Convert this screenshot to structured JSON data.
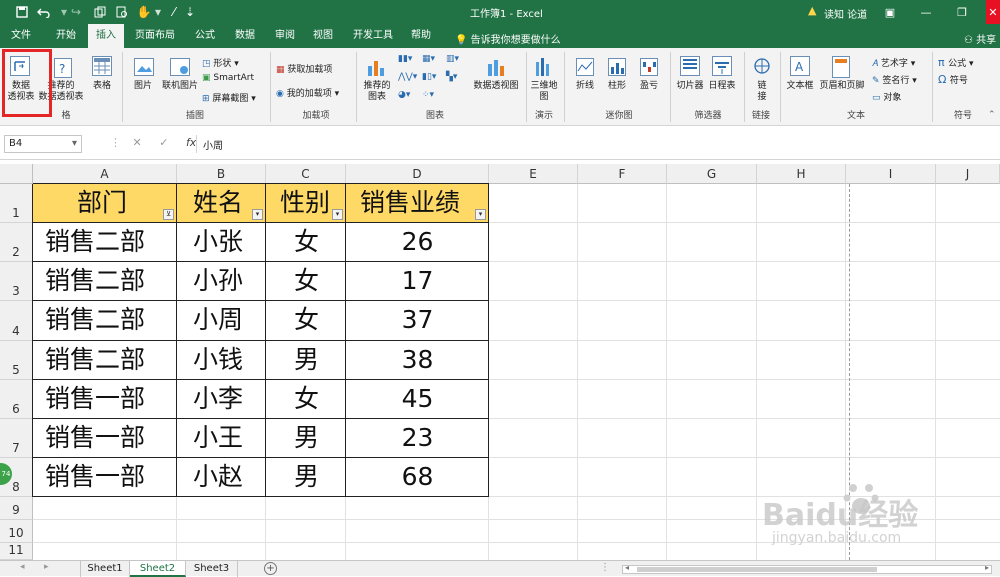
{
  "titlebar": {
    "doc_title": "工作簿1 - Excel",
    "user": "读知 论道",
    "quick_access": [
      "save-icon",
      "undo-icon",
      "redo-icon",
      "copy-icon",
      "preview-icon",
      "touch-icon",
      "more-icon"
    ]
  },
  "menu": {
    "tabs": [
      "文件",
      "开始",
      "插入",
      "页面布局",
      "公式",
      "数据",
      "审阅",
      "视图",
      "开发工具",
      "帮助"
    ],
    "active": "插入",
    "tellme": "告诉我你想要做什么",
    "share": "共享"
  },
  "ribbon": {
    "pivot_table": "数据\n透视表",
    "recommended_pivot": "推荐的\n数据透视表",
    "table": "表格",
    "group_tables": "格",
    "picture": "图片",
    "online_picture": "联机图片",
    "shapes": "形状",
    "smartart": "SmartArt",
    "screenshot": "屏幕截图",
    "group_illustrations": "插图",
    "get_addins": "获取加载项",
    "my_addins": "我的加载项",
    "group_addins": "加载项",
    "recommended_charts": "推荐的\n图表",
    "pivot_chart": "数据透视图",
    "group_charts": "图表",
    "map3d": "三维地\n图",
    "group_tours": "演示",
    "sp_line": "折线",
    "sp_column": "柱形",
    "sp_winloss": "盈亏",
    "group_sparklines": "迷你图",
    "slicer": "切片器",
    "timeline": "日程表",
    "group_filters": "筛选器",
    "link": "链\n接",
    "group_links": "链接",
    "textbox": "文本框",
    "header_footer": "页眉和页脚",
    "wordart": "艺术字",
    "signature": "签名行",
    "object": "对象",
    "group_text": "文本",
    "equation": "公式",
    "symbol": "符号",
    "group_symbols": "符号"
  },
  "formula_bar": {
    "name_box": "B4",
    "formula": "小周"
  },
  "columns": [
    "A",
    "B",
    "C",
    "D",
    "E",
    "F",
    "G",
    "H",
    "I",
    "J"
  ],
  "rows": [
    "1",
    "2",
    "3",
    "4",
    "5",
    "6",
    "7",
    "8",
    "9",
    "10",
    "11"
  ],
  "table": {
    "headers": [
      "部门",
      "姓名",
      "性别",
      "销售业绩"
    ],
    "rows": [
      [
        "销售二部",
        "小张",
        "女",
        "26"
      ],
      [
        "销售二部",
        "小孙",
        "女",
        "17"
      ],
      [
        "销售二部",
        "小周",
        "女",
        "37"
      ],
      [
        "销售二部",
        "小钱",
        "男",
        "38"
      ],
      [
        "销售一部",
        "小李",
        "女",
        "45"
      ],
      [
        "销售一部",
        "小王",
        "男",
        "23"
      ],
      [
        "销售一部",
        "小赵",
        "男",
        "68"
      ]
    ],
    "header_color": "#ffd966"
  },
  "sheets": {
    "tabs": [
      "Sheet1",
      "Sheet2",
      "Sheet3"
    ],
    "active": "Sheet2"
  },
  "accent_color": "#217346",
  "highlight_color": "#e52626",
  "watermark": {
    "text": "Baidu经验",
    "url": "jingyan.baidu.com"
  },
  "badge": "74"
}
